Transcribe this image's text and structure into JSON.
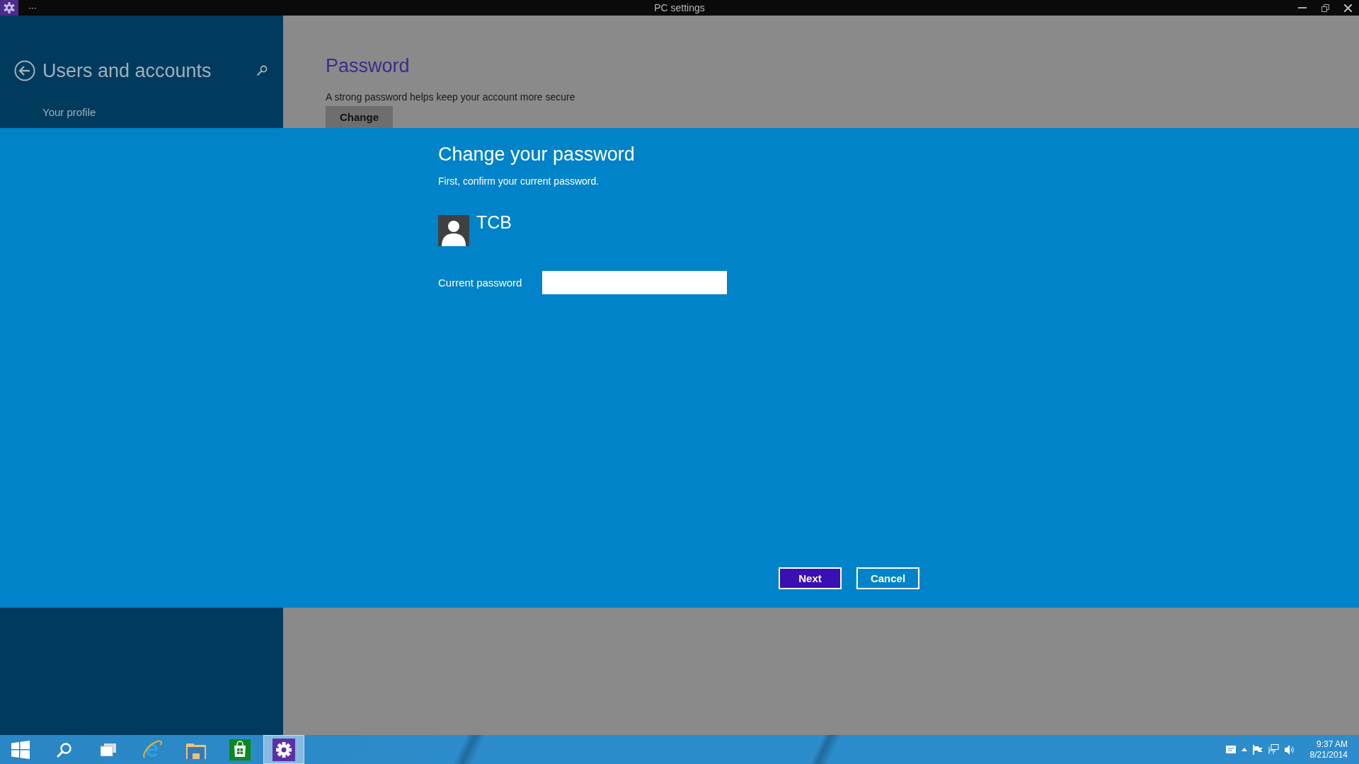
{
  "window": {
    "title": "PC settings",
    "menu": "···"
  },
  "sidebar": {
    "title": "Users and accounts",
    "items": [
      {
        "label": "Your profile"
      }
    ]
  },
  "main": {
    "section_title": "Password",
    "description": "A strong password helps keep your account more secure",
    "button": "Change"
  },
  "dialog": {
    "title": "Change your password",
    "subtitle": "First, confirm your current password.",
    "user": {
      "name": "TCB"
    },
    "field": {
      "label": "Current password"
    },
    "buttons": [
      {
        "label": "Next",
        "kind": "primary"
      },
      {
        "label": "Cancel",
        "kind": "secondary"
      }
    ]
  },
  "taskbar": {
    "apps": [
      {
        "kind": "start",
        "selected": false
      },
      {
        "kind": "search",
        "selected": false
      },
      {
        "kind": "taskview",
        "selected": false
      },
      {
        "kind": "browser",
        "selected": false
      },
      {
        "kind": "folder",
        "selected": false
      },
      {
        "kind": "store",
        "selected": false
      },
      {
        "kind": "settings",
        "selected": true
      }
    ]
  },
  "tray": {
    "icons": [
      {
        "kind": "message"
      },
      {
        "kind": "chevron"
      },
      {
        "kind": "flag"
      },
      {
        "kind": "network"
      },
      {
        "kind": "volume"
      }
    ],
    "time": "9:37 AM",
    "date": "8/21/2014"
  }
}
